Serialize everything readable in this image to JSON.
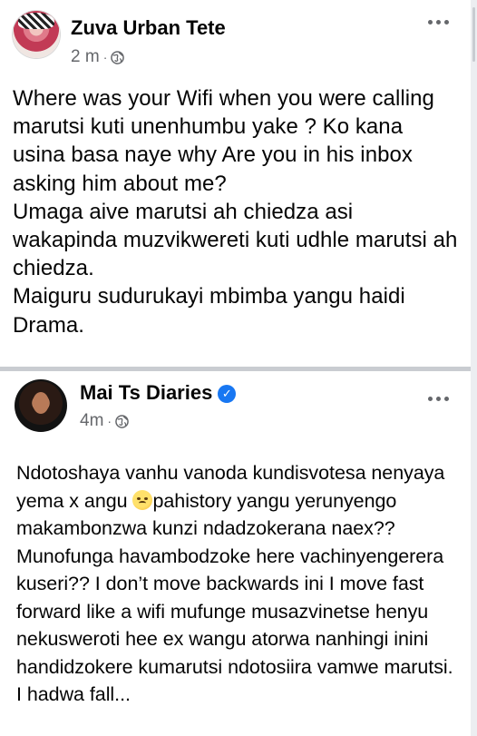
{
  "posts": [
    {
      "author": "Zuva Urban Tete",
      "time": "2 m",
      "separator": "·",
      "text": "Where was your Wifi when you were calling marutsi kuti unenhumbu yake ? Ko kana usina basa naye why Are you in his inbox asking him about me?\nUmaga aive marutsi ah chiedza asi wakapinda muzvikwereti kuti udhle marutsi ah chiedza.\nMaiguru sudurukayi mbimba yangu haidi Drama."
    },
    {
      "author": "Mai Ts Diaries",
      "verified": true,
      "time": "4m",
      "separator": "·",
      "text_before_emoji": "Ndotoshaya vanhu vanoda kundisvotesa nenyaya yema x angu ",
      "emoji": "worried-face-emoji",
      "text_after_emoji": "pahistory yangu yerunyengo makambonzwa kunzi ndadzokerana naex?? Munofunga havambodzoke here vachinyengerera kuseri?? I don’t move backwards ini I move fast forward like a wifi mufunge musazvinetse henyu nekusweroti hee ex wangu atorwa nanhingi inini handidzokere kumarutsi ndotosiira vamwe marutsi.",
      "text_cut_off": "I hadwa fall..."
    }
  ],
  "colors": {
    "text": "#050505",
    "secondary": "#65676b",
    "verified": "#1877f2",
    "divider": "#c9ccd1"
  }
}
